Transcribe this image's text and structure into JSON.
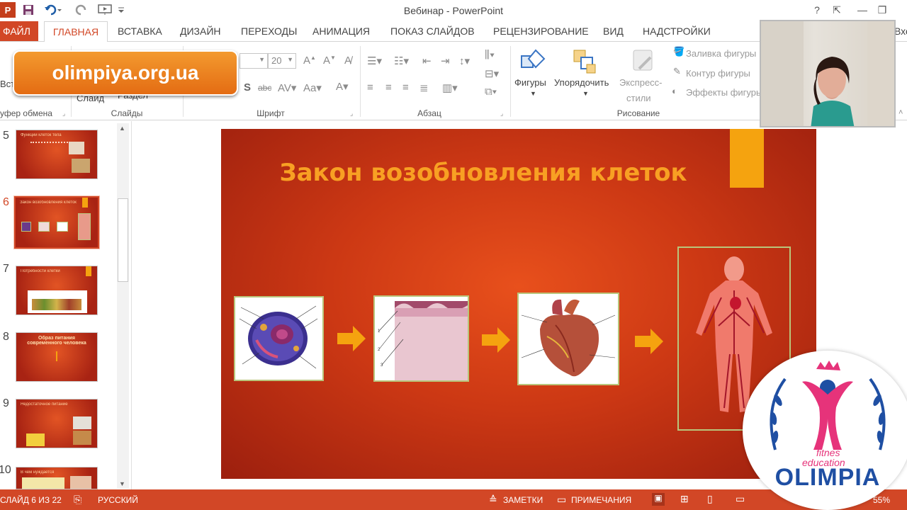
{
  "window": {
    "title": "Вебинар - PowerPoint",
    "app_badge": "P",
    "help": "?",
    "restore_ribbon": "⇱",
    "minimize": "—",
    "maximize": "❐",
    "close": "✕",
    "signin_partial": "Вхо"
  },
  "tabs": [
    "ФАЙЛ",
    "ГЛАВНАЯ",
    "ВСТАВКА",
    "ДИЗАЙН",
    "ПЕРЕХОДЫ",
    "АНИМАЦИЯ",
    "ПОКАЗ СЛАЙДОВ",
    "РЕЦЕНЗИРОВАНИЕ",
    "ВИД",
    "НАДСТРОЙКИ"
  ],
  "ribbon": {
    "clipboard_label": "уфер обмена",
    "paste_partial": "Вст",
    "slides_label": "Слайды",
    "slide_partial": "Слайд",
    "section_partial": "Раздел",
    "font_label": "Шрифт",
    "font_size": "20",
    "paragraph_label": "Абзац",
    "drawing_label": "Рисование",
    "shapes": "Фигуры",
    "arrange": "Упорядочить",
    "quick_styles_1": "Экспресс-",
    "quick_styles_2": "стили",
    "shape_fill": "Заливка фигуры",
    "shape_outline": "Контур фигуры",
    "shape_effects": "Эффекты фигуры"
  },
  "banner": {
    "text": "olimpiya.org.ua"
  },
  "thumbnails": [
    {
      "num": "5",
      "title": "Функции клеток тела"
    },
    {
      "num": "6",
      "title": "Закон возобновления клеток",
      "selected": true
    },
    {
      "num": "7",
      "title": "Потребности клетки"
    },
    {
      "num": "8",
      "title": "Образ питания современного человека"
    },
    {
      "num": "9",
      "title": "Недостаточное питание"
    },
    {
      "num": "10",
      "title": "В чем нуждается"
    }
  ],
  "slide": {
    "title": "Закон возобновления клеток"
  },
  "logo": {
    "word": "OLIMPIA",
    "tag1": "fitnes",
    "tag2": "education"
  },
  "status": {
    "slide_counter": "СЛАЙД 6 ИЗ 22",
    "language": "РУССКИЙ",
    "notes": "ЗАМЕТКИ",
    "comments": "ПРИМЕЧАНИЯ",
    "zoom_partial": "55%"
  },
  "colors": {
    "accent": "#d24726",
    "slide_title": "#f8a023",
    "slide_bar": "#f5a30f",
    "logo_blue": "#1f4fa3",
    "logo_pink": "#e6337a"
  }
}
